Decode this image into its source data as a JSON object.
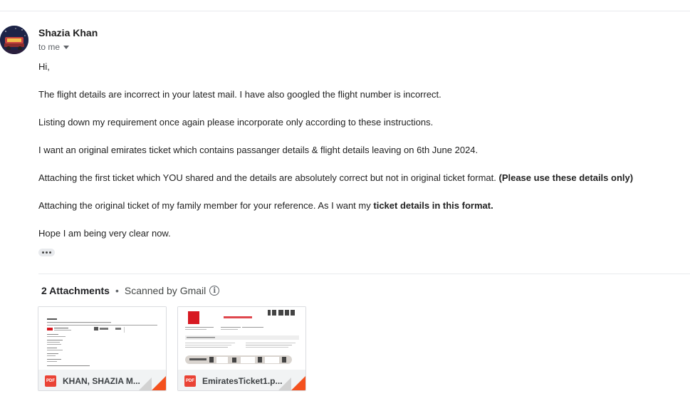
{
  "sender": {
    "name": "Shazia Khan",
    "recipient": "to me"
  },
  "message": {
    "greeting": "Hi,",
    "p1": "The flight details are incorrect in your latest mail. I have also googled the flight number is incorrect.",
    "p2": "Listing down my requirement once again please incorporate only according to these instructions.",
    "p3": "I want an original emirates ticket which contains passanger details & flight details leaving on 6th June 2024.",
    "p4_text": "Attaching the first ticket which YOU shared and the details are absolutely correct but not in original ticket format.",
    "p4_bold": "(Please use these details only)",
    "p5_text": "Attaching the original ticket of my family  member for your reference. As I want my",
    "p5_bold": "ticket details in this format.",
    "p6": "Hope I am being very clear now."
  },
  "attachments": {
    "count_label": "2 Attachments",
    "separator": "•",
    "scan_label": "Scanned by Gmail",
    "info_icon": "i",
    "items": [
      {
        "name": "KHAN, SHAZIA M...",
        "type_badge": "PDF",
        "icon": "pdf-icon"
      },
      {
        "name": "EmiratesTicket1.p...",
        "type_badge": "PDF",
        "icon": "pdf-icon"
      }
    ]
  },
  "colors": {
    "pdf_red": "#ea4335",
    "corner_orange": "#f4511e",
    "emirates_red": "#d71921"
  }
}
